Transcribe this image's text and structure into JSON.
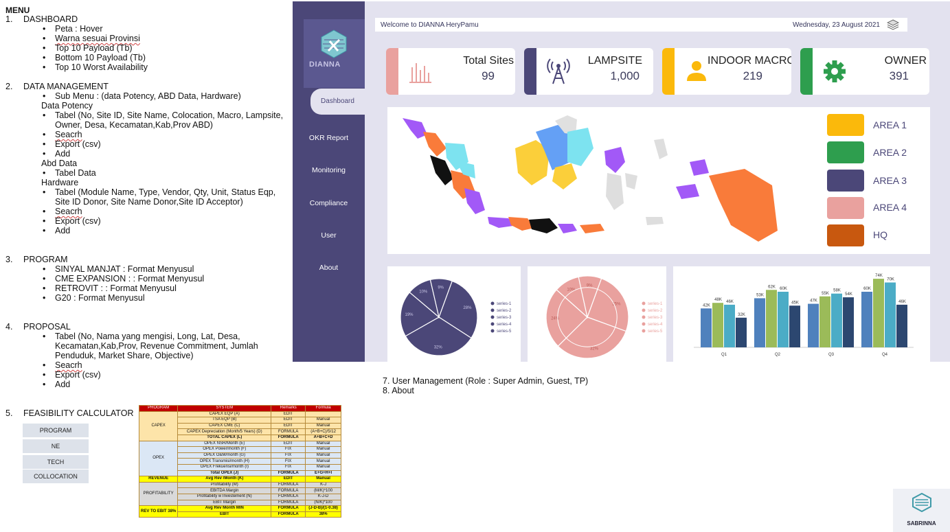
{
  "notes": {
    "title": "MENU",
    "s1": {
      "num": "1.",
      "title": "DASHBOARD",
      "items": [
        "Peta : Hover",
        "Warna sesuai Provinsi",
        "Top 10 Payload (Tb)",
        "Bottom 10 Payload (Tb)",
        "Top 10 Worst Availability"
      ]
    },
    "s2": {
      "num": "2.",
      "title": "DATA MANAGEMENT",
      "submenu": "Sub Menu : (data Potency, ABD Data, Hardware)",
      "potency": "Data Potency",
      "potency_items": [
        "Tabel (No, Site ID, Site Name, Colocation, Macro, Lampsite,",
        "Owner, Desa, Kecamatan,Kab,Prov ABD)",
        "Seacrh",
        "Export (csv)",
        "Add"
      ],
      "abd": "Abd Data",
      "abd_items": [
        "Tabel Data"
      ],
      "hardware": "Hardware",
      "hw_items": [
        "Tabel (Module Name, Type, Vendor, Qty, Unit, Status Eqp,",
        "Site ID Donor, Site Name Donor,Site ID Acceptor)",
        "Seacrh",
        "Export (csv)",
        "Add"
      ]
    },
    "s3": {
      "num": "3.",
      "title": "PROGRAM",
      "items": [
        "SINYAL MANJAT : Format Menyusul",
        "CME EXPANSION : : Format Menyusul",
        "RETROVIT : : Format Menyusul",
        "G20 : Format Menyusul"
      ]
    },
    "s4": {
      "num": "4.",
      "title": "PROPOSAL",
      "items": [
        "Tabel (No, Nama yang mengisi, Long, Lat, Desa,",
        "Kecamatan,Kab,Prov, Revenue Commitment, Jumlah",
        "Penduduk, Market Share, Objective)",
        "Seacrh",
        "Export (csv)",
        "Add"
      ]
    },
    "s5": {
      "num": "5.",
      "title": "FEASIBILITY CALCULATOR",
      "buttons": [
        "PROGRAM",
        "NE",
        "TECH",
        "COLLOCATION"
      ]
    },
    "s7": "7. User Management (Role : Super Admin, Guest, TP)",
    "s8": "8. About"
  },
  "feasibility_table": {
    "headers": [
      "PROGRAM",
      "SYSTEM",
      "Remarks",
      "Formula"
    ],
    "groups": {
      "capex": "CAPEX",
      "opex": "OPEX",
      "revenue": "REVENUE",
      "profit": "PROFITABILITY",
      "rev_ebit": "REV TO EBIT 38%"
    },
    "rows": [
      [
        "CAPEX EQP (A)",
        "EDIT",
        ""
      ],
      [
        "TSA EQP (B)",
        "EDIT",
        "Manual"
      ],
      [
        "CAPEX CME (C)",
        "EDIT",
        "Manual"
      ],
      [
        "CAPEX Depreciation (Month/5 Years) (D)",
        "FORMULA",
        "(A+B+C)/5/12"
      ],
      [
        "TOTAL CAPEX (L)",
        "FORMULA",
        "A+B+C+D"
      ],
      [
        "OPEX NSR/Month (E)",
        "EDIT",
        "Manual"
      ],
      [
        "OPEX Power/month (F)",
        "FIX",
        "Manual"
      ],
      [
        "OPEX O&M/month (G)",
        "FIX",
        "Manual"
      ],
      [
        "OPEX Transmisi/month (H)",
        "FIX",
        "Manual"
      ],
      [
        "OPEX Frekuensi/month (I)",
        "FIX",
        "Manual"
      ],
      [
        "Total OPEX (J)",
        "FORMULA",
        "E+G+H+I"
      ],
      [
        "Avg Rev /Month (K)",
        "EDIT",
        "Manual"
      ],
      [
        "Profitability (M)",
        "FORMULA",
        "K-J"
      ],
      [
        "EBITDA Margin",
        "FORMULA",
        "(M/K)*100"
      ],
      [
        "Profitability w Investement (N)",
        "FORMULA",
        "K-J-D"
      ],
      [
        "EBIT Margin",
        "FORMULA",
        "(N/K)*100"
      ],
      [
        "Avg Rev Month MIN",
        "FORMULA",
        "(J-D-B)/(1-0.38)"
      ],
      [
        "EBIT",
        "FORMULA",
        "38%"
      ]
    ]
  },
  "dashboard": {
    "logo_text": "DIANNA",
    "nav": [
      "Dashboard",
      "OKR Report",
      "Monitoring",
      "Compliance",
      "User",
      "About"
    ],
    "welcome": "Welcome to DIANNA HeryPamu",
    "date": "Wednesday, 23 August 2021",
    "kpis": [
      {
        "label": "Total Sites",
        "value": "99",
        "color": "#e9a19e"
      },
      {
        "label": "LAMPSITE",
        "value": "1,000",
        "color": "#4b4778"
      },
      {
        "label": "INDOOR MACRO",
        "value": "219",
        "color": "#fbb90b"
      },
      {
        "label": "OWNER",
        "value": "391",
        "color": "#2e9e4e"
      }
    ],
    "map_legend": [
      {
        "label": "AREA 1",
        "color": "#fbb90b"
      },
      {
        "label": "AREA 2",
        "color": "#2e9e4e"
      },
      {
        "label": "AREA 3",
        "color": "#4b4778"
      },
      {
        "label": "AREA 4",
        "color": "#e9a19e"
      },
      {
        "label": "HQ",
        "color": "#c8580f"
      }
    ],
    "brand": "SABRINNA"
  },
  "chart_data": [
    {
      "type": "pie",
      "series_labels": [
        "series-1",
        "series-2",
        "series-3",
        "series-4",
        "series-5"
      ],
      "values": [
        28,
        32,
        19,
        10,
        9
      ],
      "labels": [
        "28%",
        "32%",
        "19%",
        "10%",
        "9%"
      ],
      "color": "#4b4778"
    },
    {
      "type": "pie",
      "series_labels": [
        "series-1",
        "series-2",
        "series-3",
        "series-4",
        "series-5"
      ],
      "values": [
        25,
        32,
        24,
        10,
        9
      ],
      "labels": [
        "25%",
        "32%",
        "24%",
        "10%",
        "9%"
      ],
      "color": "#e9a19e"
    },
    {
      "type": "bar",
      "categories": [
        "Q1",
        "Q2",
        "Q3",
        "Q4"
      ],
      "series": [
        {
          "values": [
            42,
            53,
            47,
            60
          ],
          "color": "#4f81bd"
        },
        {
          "values": [
            48,
            62,
            55,
            74
          ],
          "color": "#9bbb59"
        },
        {
          "values": [
            46,
            60,
            58,
            70
          ],
          "color": "#4bacc6"
        },
        {
          "values": [
            32,
            45,
            54,
            46
          ],
          "color": "#2c4770"
        }
      ],
      "labels": [
        [
          "42K",
          "48K",
          "46K",
          "32K"
        ],
        [
          "53K",
          "62K",
          "60K",
          "45K"
        ],
        [
          "47K",
          "55K",
          "58K",
          "54K"
        ],
        [
          "60K",
          "74K",
          "70K",
          "46K"
        ]
      ],
      "ylim": [
        0,
        80
      ]
    }
  ]
}
